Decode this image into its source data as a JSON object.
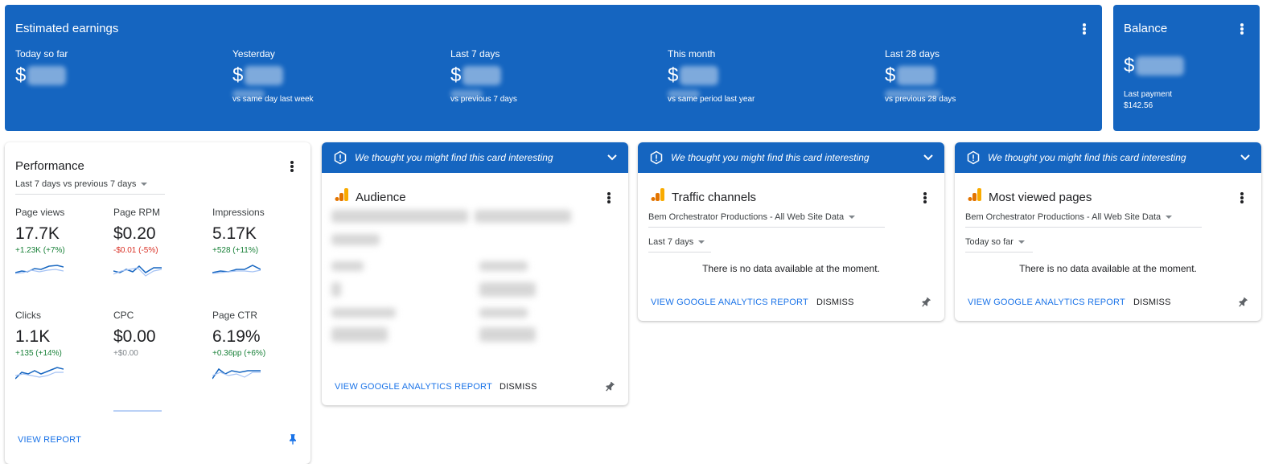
{
  "earnings": {
    "title": "Estimated earnings",
    "metrics": [
      {
        "label": "Today so far",
        "value": "$",
        "compare": ""
      },
      {
        "label": "Yesterday",
        "value": "$",
        "compare": "vs same day last week"
      },
      {
        "label": "Last 7 days",
        "value": "$",
        "compare": "vs previous 7 days"
      },
      {
        "label": "This month",
        "value": "$",
        "compare": "vs same period last year"
      },
      {
        "label": "Last 28 days",
        "value": "$",
        "compare": "vs previous 28 days"
      }
    ]
  },
  "balance": {
    "title": "Balance",
    "value": "$",
    "last_payment_label": "Last payment",
    "last_payment_value": "$142.56"
  },
  "performance": {
    "title": "Performance",
    "range": "Last 7 days vs previous 7 days",
    "metrics": [
      {
        "label": "Page views",
        "value": "17.7K",
        "change": "+1.23K (+7%)",
        "trend": "up"
      },
      {
        "label": "Page RPM",
        "value": "$0.20",
        "change": "-$0.01 (-5%)",
        "trend": "down"
      },
      {
        "label": "Impressions",
        "value": "5.17K",
        "change": "+528 (+11%)",
        "trend": "up"
      },
      {
        "label": "Clicks",
        "value": "1.1K",
        "change": "+135 (+14%)",
        "trend": "up"
      },
      {
        "label": "CPC",
        "value": "$0.00",
        "change": "+$0.00",
        "trend": "flat"
      },
      {
        "label": "Page CTR",
        "value": "6.19%",
        "change": "+0.36pp (+6%)",
        "trend": "up"
      }
    ],
    "view_report": "VIEW REPORT"
  },
  "suggestion_banner": "We thought you might find this card interesting",
  "cards": [
    {
      "title": "Audience",
      "property": "",
      "range": "",
      "message": "",
      "link": "VIEW GOOGLE ANALYTICS REPORT",
      "dismiss": "DISMISS"
    },
    {
      "title": "Traffic channels",
      "property": "Bem Orchestrator Productions - All Web Site Data",
      "range": "Last 7 days",
      "message": "There is no data available at the moment.",
      "link": "VIEW GOOGLE ANALYTICS REPORT",
      "dismiss": "DISMISS"
    },
    {
      "title": "Most viewed pages",
      "property": "Bem Orchestrator Productions - All Web Site Data",
      "range": "Today so far",
      "message": "There is no data available at the moment.",
      "link": "VIEW GOOGLE ANALYTICS REPORT",
      "dismiss": "DISMISS"
    }
  ],
  "colors": {
    "brand_blue": "#1565c0",
    "link_blue": "#1a73e8",
    "positive": "#188038",
    "negative": "#d93025",
    "ga_orange": "#f9ab00"
  },
  "icons": [
    "more-vert-icon",
    "alert-icon",
    "chevron-down-icon",
    "analytics-icon",
    "pin-icon",
    "caret-down-icon"
  ]
}
